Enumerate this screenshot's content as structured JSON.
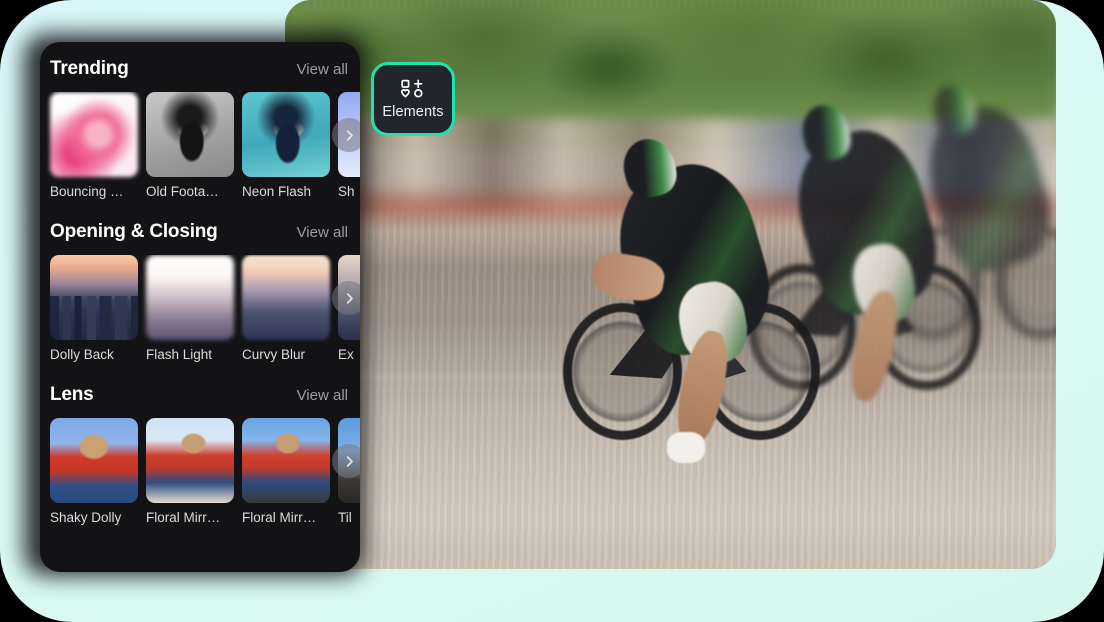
{
  "theme": {
    "page_background": "#d8f6fb",
    "panel_background": "#131316",
    "accent": "#1fe3ad",
    "section_title_color": "#ffffff",
    "view_all_color": "#9a9ea4",
    "card_label_color": "#dcdcdc"
  },
  "elements_button": {
    "label": "Elements",
    "icon": "elements-grid-icon",
    "selected": true,
    "border_color": "#1fe3ad"
  },
  "panel": {
    "sections": [
      {
        "title": "Trending",
        "view_all_label": "View all",
        "next_icon": "chevron-right-icon",
        "cards": [
          {
            "label": "Bouncing …",
            "art": "t-bounce"
          },
          {
            "label": "Old Foota…",
            "art": "t-oldfoot"
          },
          {
            "label": "Neon Flash",
            "art": "t-neon"
          },
          {
            "label": "Sh",
            "art": "t-shine"
          }
        ]
      },
      {
        "title": "Opening & Closing",
        "view_all_label": "View all",
        "next_icon": "chevron-right-icon",
        "cards": [
          {
            "label": "Dolly Back",
            "art": "t-city"
          },
          {
            "label": "Flash Light",
            "art": "t-flash"
          },
          {
            "label": "Curvy Blur",
            "art": "t-curvy"
          },
          {
            "label": "Ex",
            "art": "t-ex"
          }
        ]
      },
      {
        "title": "Lens",
        "view_all_label": "View all",
        "next_icon": "chevron-right-icon",
        "cards": [
          {
            "label": "Shaky Dolly",
            "art": "t-lens"
          },
          {
            "label": "Floral Mirr…",
            "art": "t-lens2"
          },
          {
            "label": "Floral Mirr…",
            "art": "t-lens3"
          },
          {
            "label": "Til",
            "art": "t-tilt"
          }
        ]
      }
    ]
  },
  "preview": {
    "name": "cyclists-motion-blur-photo",
    "alt": "Motion-blurred photograph of road cyclists racing"
  }
}
